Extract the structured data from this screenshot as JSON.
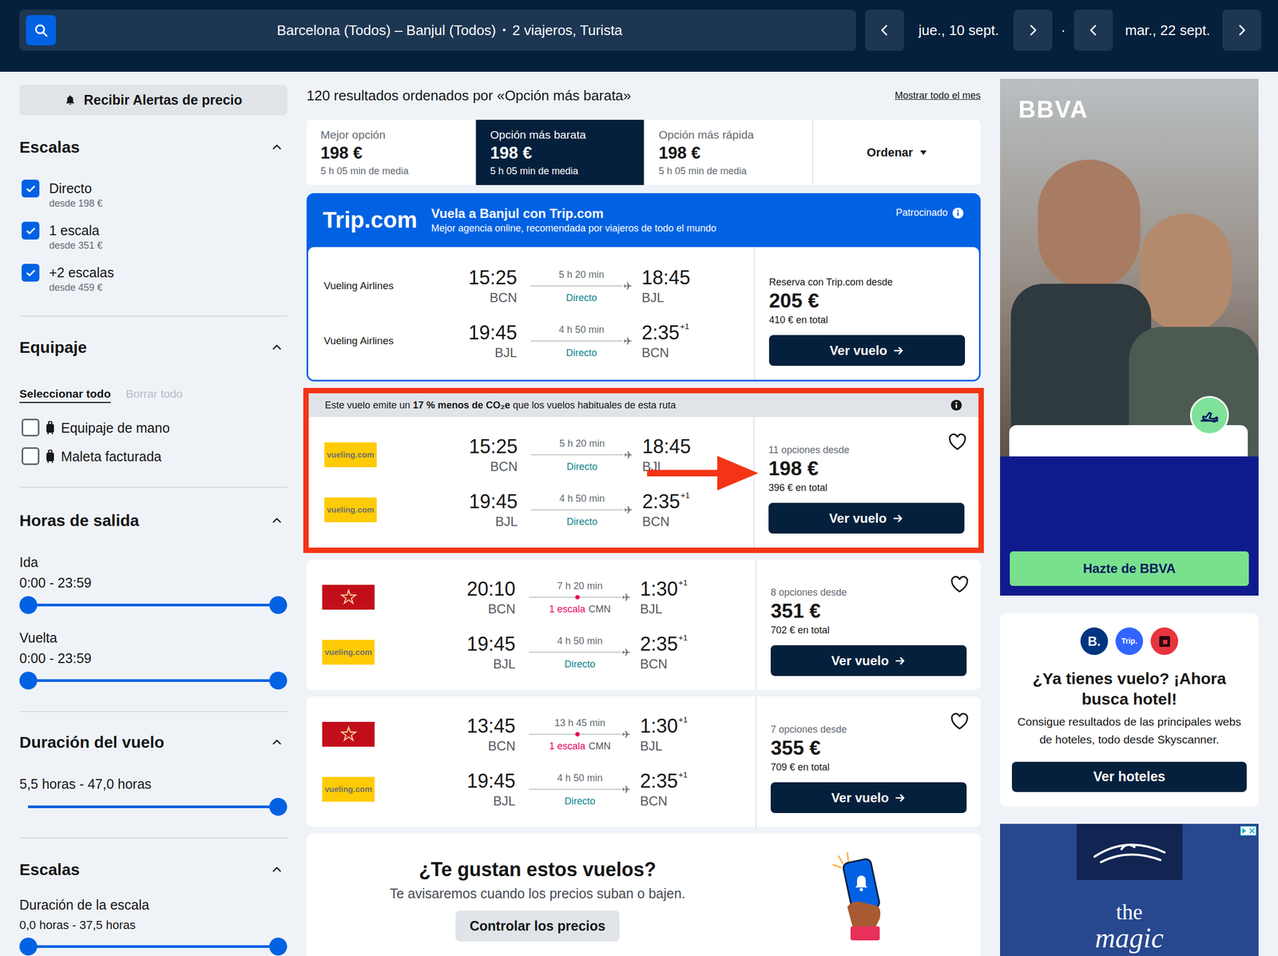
{
  "header": {
    "route": "Barcelona (Todos) – Banjul (Todos)",
    "separator": "•",
    "travellers": "2 viajeros, Turista",
    "outbound_date": "jue., 10 sept.",
    "date_separator": "·",
    "return_date": "mar., 22 sept."
  },
  "sidebar": {
    "alert_button": "Recibir Alertas de precio",
    "stops": {
      "title": "Escalas",
      "expanded": true,
      "options": [
        {
          "label": "Directo",
          "sub": "desde 198 €",
          "checked": true
        },
        {
          "label": "1 escala",
          "sub": "desde 351 €",
          "checked": true
        },
        {
          "label": "+2 escalas",
          "sub": "desde 459 €",
          "checked": true
        }
      ]
    },
    "baggage": {
      "title": "Equipaje",
      "expanded": true,
      "select_all": "Seleccionar todo",
      "clear_all": "Borrar todo",
      "clear_all_disabled": true,
      "options": [
        {
          "label": "Equipaje de mano",
          "checked": false
        },
        {
          "label": "Maleta facturada",
          "checked": false
        }
      ]
    },
    "departure": {
      "title": "Horas de salida",
      "expanded": true,
      "sliders": [
        {
          "label": "Ida",
          "range": "0:00 - 23:59",
          "low": 0,
          "high": 1
        },
        {
          "label": "Vuelta",
          "range": "0:00 - 23:59",
          "low": 0,
          "high": 1
        }
      ]
    },
    "duration": {
      "title": "Duración del vuelo",
      "expanded": true,
      "range": "5,5 horas - 47,0 horas",
      "level": 1
    },
    "layover": {
      "title": "Escalas",
      "expanded": true,
      "label": "Duración de la escala",
      "range": "0,0 horas - 37,5 horas",
      "low": 0,
      "high": 1
    }
  },
  "results_header": {
    "summary": "120 resultados ordenados por «Opción más barata»",
    "month_link": "Mostrar todo el mes"
  },
  "sort_tabs": [
    {
      "label": "Mejor opción",
      "price": "198 €",
      "sub": "5 h 05 min de media",
      "selected": false
    },
    {
      "label": "Opción más barata",
      "price": "198 €",
      "sub": "5 h 05 min de media",
      "selected": true
    },
    {
      "label": "Opción más rápida",
      "price": "198 €",
      "sub": "5 h 05 min de media",
      "selected": false
    }
  ],
  "sort_menu": {
    "label": "Ordenar"
  },
  "sponsored": {
    "brand": "Trip.com",
    "title": "Vuela a Banjul con Trip.com",
    "subtitle": "Mejor agencia online, recomendada por viajeros de todo el mundo",
    "badge": "Patrocinado",
    "legs": [
      {
        "kind": "text",
        "airline": "Vueling Airlines",
        "dep_time": "15:25",
        "dep_code": "BCN",
        "duration": "5 h 20 min",
        "stops": "Directo",
        "stop_kind": "direct",
        "arr_time": "18:45",
        "arr_code": "BJL"
      },
      {
        "kind": "text",
        "airline": "Vueling Airlines",
        "dep_time": "19:45",
        "dep_code": "BJL",
        "duration": "4 h 50 min",
        "stops": "Directo",
        "stop_kind": "direct",
        "arr_time": "2:35",
        "day_offset": "+1",
        "arr_code": "BCN"
      }
    ],
    "price_label": "Reserva con Trip.com desde",
    "price": "205 €",
    "total": "410 € en total",
    "button": "Ver vuelo"
  },
  "results": [
    {
      "highlighted": true,
      "annotated": true,
      "eco_note": {
        "pre": "Este vuelo emite un ",
        "bold": "17 % menos de CO₂e",
        "post": " que los vuelos habituales de esta ruta"
      },
      "favorite": false,
      "legs": [
        {
          "kind": "vueling",
          "logo_text": "vueling.com",
          "dep_time": "15:25",
          "dep_code": "BCN",
          "duration": "5 h 20 min",
          "stops": "Directo",
          "stop_kind": "direct",
          "arr_time": "18:45",
          "arr_code": "BJL"
        },
        {
          "kind": "vueling",
          "logo_text": "vueling.com",
          "dep_time": "19:45",
          "dep_code": "BJL",
          "duration": "4 h 50 min",
          "stops": "Directo",
          "stop_kind": "direct",
          "arr_time": "2:35",
          "day_offset": "+1",
          "arr_code": "BCN"
        }
      ],
      "options": "11 opciones desde",
      "price": "198 €",
      "total": "396 € en total",
      "button": "Ver vuelo"
    },
    {
      "highlighted": false,
      "annotated": false,
      "favorite": false,
      "legs": [
        {
          "kind": "ram",
          "dep_time": "20:10",
          "dep_code": "BCN",
          "duration": "7 h 20 min",
          "stops": "1 escala",
          "via": "CMN",
          "stop_kind": "stop",
          "arr_time": "1:30",
          "day_offset": "+1",
          "arr_code": "BJL"
        },
        {
          "kind": "vueling",
          "logo_text": "vueling.com",
          "dep_time": "19:45",
          "dep_code": "BJL",
          "duration": "4 h 50 min",
          "stops": "Directo",
          "stop_kind": "direct",
          "arr_time": "2:35",
          "day_offset": "+1",
          "arr_code": "BCN"
        }
      ],
      "options": "8 opciones desde",
      "price": "351 €",
      "total": "702 € en total",
      "button": "Ver vuelo"
    },
    {
      "highlighted": false,
      "annotated": false,
      "favorite": false,
      "legs": [
        {
          "kind": "ram",
          "dep_time": "13:45",
          "dep_code": "BCN",
          "duration": "13 h 45 min",
          "stops": "1 escala",
          "via": "CMN",
          "stop_kind": "stop",
          "arr_time": "1:30",
          "day_offset": "+1",
          "arr_code": "BJL"
        },
        {
          "kind": "vueling",
          "logo_text": "vueling.com",
          "dep_time": "19:45",
          "dep_code": "BJL",
          "duration": "4 h 50 min",
          "stops": "Directo",
          "stop_kind": "direct",
          "arr_time": "2:35",
          "day_offset": "+1",
          "arr_code": "BCN"
        }
      ],
      "options": "7 opciones desde",
      "price": "355 €",
      "total": "709 € en total",
      "button": "Ver vuelo"
    }
  ],
  "price_alert": {
    "title": "¿Te gustan estos vuelos?",
    "text": "Te avisaremos cuando los precios suban o bajen.",
    "button": "Controlar los precios"
  },
  "ads": {
    "bbva": {
      "brand": "BBVA",
      "button": "Hazte de BBVA"
    },
    "hotel": {
      "logos": [
        {
          "kind": "text",
          "text": "B.",
          "color": "#003580"
        },
        {
          "kind": "text",
          "text": "Trip.",
          "color": "#3264ff"
        },
        {
          "kind": "icon",
          "color": "#e8343f"
        }
      ],
      "title": "¿Ya tienes vuelo? ¡Ahora busca hotel!",
      "text": "Consigue resultados de las principales webs de hoteles, todo desde Skyscanner.",
      "button": "Ver hoteles"
    },
    "cruise": {
      "line1": "the",
      "line2": "magic"
    }
  }
}
